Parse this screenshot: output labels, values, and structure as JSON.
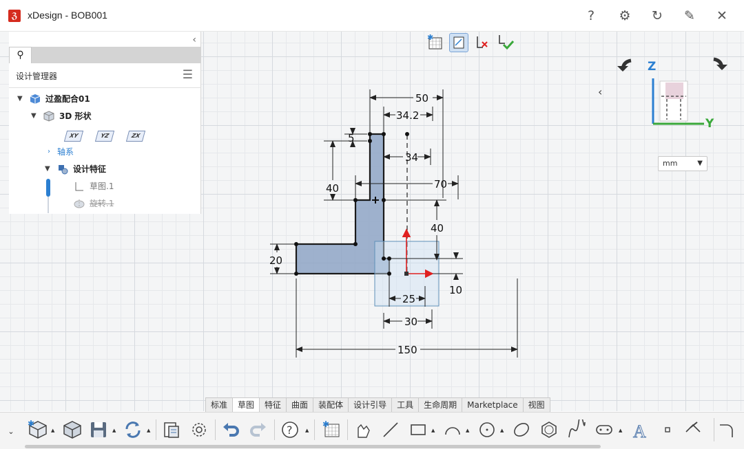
{
  "window": {
    "title": "xDesign - BOB001"
  },
  "titlebar_buttons": [
    "help-icon",
    "settings-icon",
    "refresh-icon",
    "pin-icon",
    "close-icon"
  ],
  "panel": {
    "title": "设计管理器",
    "tree": [
      {
        "label": "过盈配合01",
        "level": 0
      },
      {
        "label": "3D 形状",
        "level": 1
      },
      {
        "label": "轴系",
        "level": 2
      },
      {
        "label": "设计特征",
        "level": 2
      },
      {
        "label": "草图.1",
        "level": 3
      },
      {
        "label": "旋转.1",
        "level": 3,
        "struck": true
      }
    ],
    "planes": [
      "XY",
      "YZ",
      "ZX"
    ]
  },
  "viewcube": {
    "axis_z": "Z",
    "axis_y": "Y"
  },
  "units": {
    "value": "mm"
  },
  "dimensions": {
    "d50": "50",
    "d34_2": "34.2",
    "d5": "5",
    "d34": "34",
    "d40a": "40",
    "d70": "70",
    "d40b": "40",
    "d20": "20",
    "d10": "10",
    "d25": "25",
    "d30": "30",
    "d150": "150"
  },
  "tabs": [
    "标准",
    "草图",
    "特征",
    "曲面",
    "装配体",
    "设计引导",
    "工具",
    "生命周期",
    "Marketplace",
    "视图"
  ],
  "active_tab": "草图",
  "colors": {
    "accent": "#2b7fd1",
    "profile_fill": "#8ea5c6",
    "axis_red": "#e02020",
    "axis_green": "#3aa83a"
  }
}
